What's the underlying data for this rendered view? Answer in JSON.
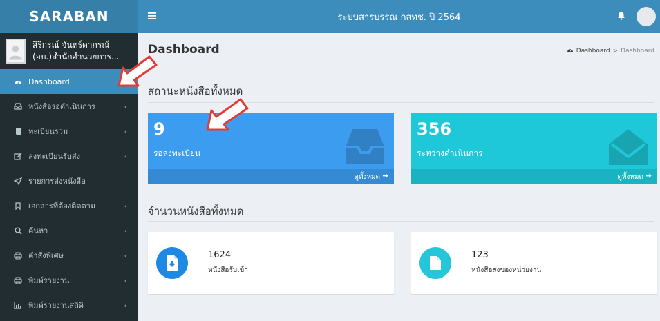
{
  "app": {
    "logo": "SARABAN",
    "title": "ระบบสารบรรณ กสทช. ปี 2564"
  },
  "user": {
    "name": "สิริกรณ์ จันทร์ดากรณ์",
    "dept": "(อบ.)สำนักอำนวยการ..."
  },
  "sidebar": {
    "items": [
      {
        "label": "Dashboard",
        "icon": "dashboard-icon",
        "active": true,
        "has_children": false
      },
      {
        "label": "หนังสือรอดำเนินการ",
        "icon": "inbox-icon",
        "active": false,
        "has_children": true
      },
      {
        "label": "ทะเบียนรวม",
        "icon": "book-icon",
        "active": false,
        "has_children": true
      },
      {
        "label": "ลงทะเบียนรับส่ง",
        "icon": "edit-icon",
        "active": false,
        "has_children": true
      },
      {
        "label": "รายการส่งหนังสือ",
        "icon": "send-icon",
        "active": false,
        "has_children": false
      },
      {
        "label": "เอกสารที่ต้องติดตาม",
        "icon": "bookmark-icon",
        "active": false,
        "has_children": true
      },
      {
        "label": "ค้นหา",
        "icon": "search-icon",
        "active": false,
        "has_children": true
      },
      {
        "label": "คำสั่งพิเศษ",
        "icon": "print-icon",
        "active": false,
        "has_children": true
      },
      {
        "label": "พิมพ์รายงาน",
        "icon": "print-icon",
        "active": false,
        "has_children": true
      },
      {
        "label": "พิมพ์รายงานสถิติ",
        "icon": "bar-chart-icon",
        "active": false,
        "has_children": true
      }
    ]
  },
  "page": {
    "title": "Dashboard",
    "breadcrumb": {
      "home": "Dashboard",
      "sep": ">",
      "current": "Dashboard"
    }
  },
  "status_section": {
    "title": "สถานะหนังสือทั้งหมด",
    "boxes": [
      {
        "value": "9",
        "label": "รอลงทะเบียน",
        "link": "ดูทั้งหมด",
        "color": "#3c9df0"
      },
      {
        "value": "356",
        "label": "ระหว่างดำเนินการ",
        "link": "ดูทั้งหมด",
        "color": "#1fc8d8"
      }
    ]
  },
  "count_section": {
    "title": "จำนวนหนังสือทั้งหมด",
    "boxes": [
      {
        "value": "1624",
        "label": "หนังสือรับเข้า",
        "color": "#1e88e5"
      },
      {
        "value": "123",
        "label": "หนังสือส่งของหน่วยงาน",
        "color": "#26c6da"
      }
    ]
  },
  "colors": {
    "sidebar_bg": "#222d32",
    "topbar": "#3c8dbc",
    "active": "#3c8dbc",
    "arrow": "#e53935"
  }
}
